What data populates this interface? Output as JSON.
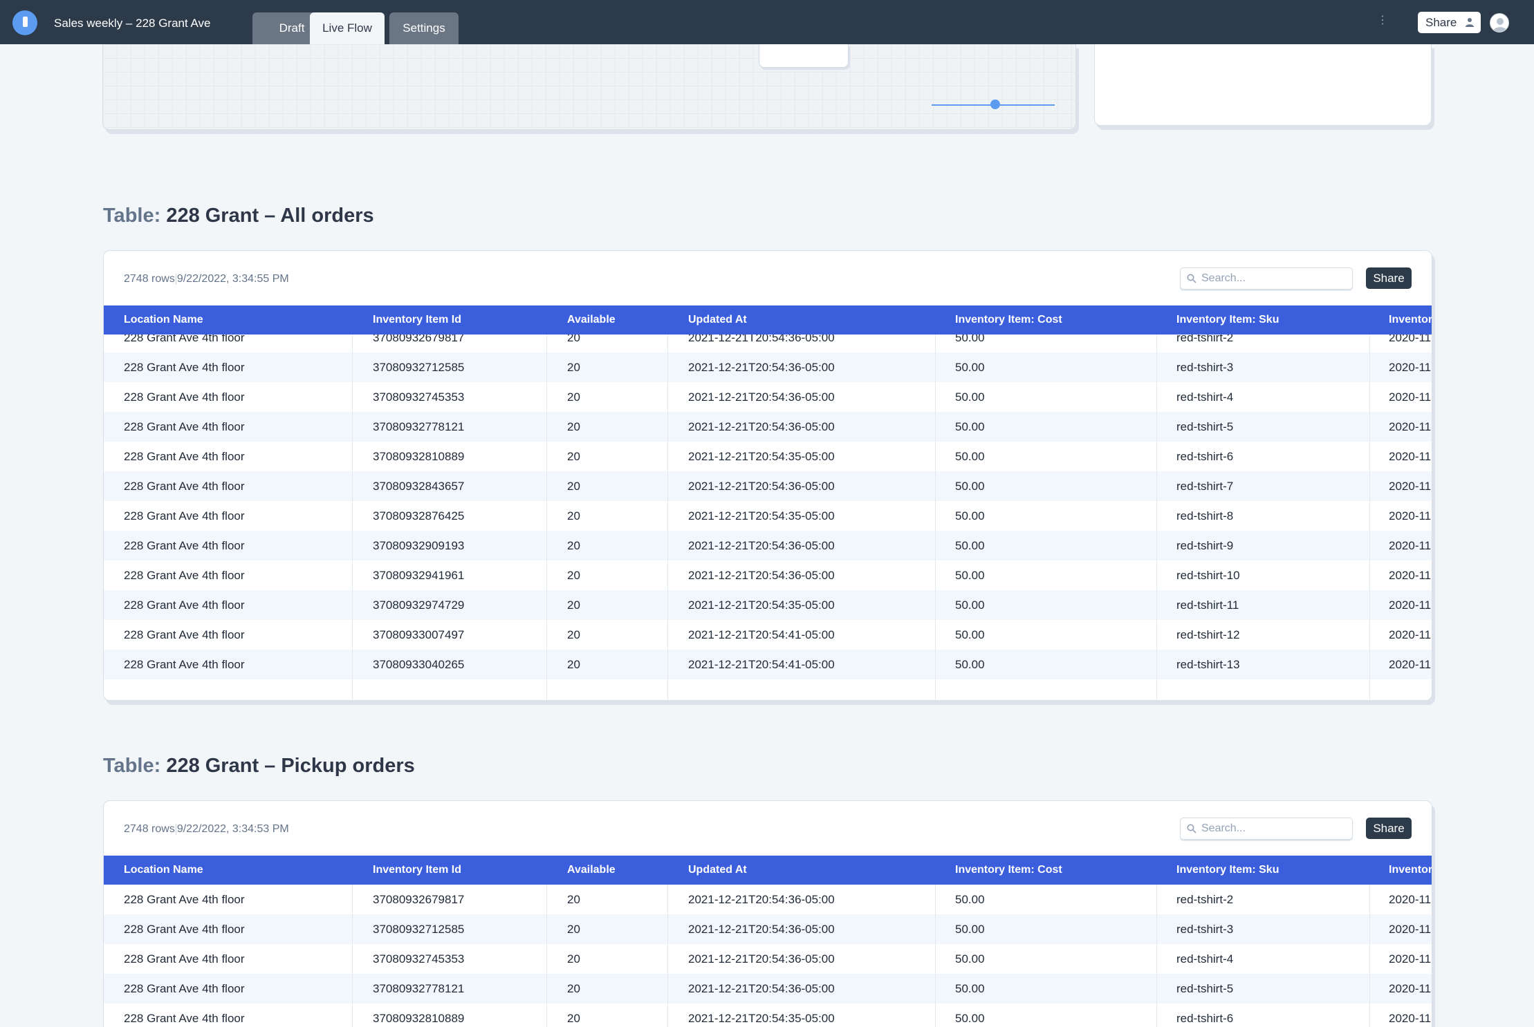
{
  "header": {
    "doc_title": "Sales weekly – 228 Grant Ave",
    "tabs": [
      {
        "label": "Draft",
        "active": false
      },
      {
        "label": "Live Flow",
        "active": true
      },
      {
        "label": "Settings",
        "active": false
      }
    ],
    "more_icon": "vertical-dots-icon",
    "share_label": "Share",
    "share_icon": "person-icon",
    "avatar_icon": "user-avatar-icon"
  },
  "colors": {
    "topbar": "#2d3a4a",
    "accent_blue": "#5b9cf0",
    "table_header": "#3b5fdc",
    "page_bg": "#f3f6f9"
  },
  "tables": [
    {
      "title_prefix": "Table:",
      "title": "228 Grant – All orders",
      "row_count": "2748 rows",
      "timestamp": "9/22/2022, 3:34:55 PM",
      "search_placeholder": "Search...",
      "share_label": "Share",
      "columns": [
        "Location Name",
        "Inventory Item Id",
        "Available",
        "Updated At",
        "Inventory Item: Cost",
        "Inventory Item: Sku",
        "Inventor"
      ],
      "rows": [
        [
          "228 Grant Ave 4th floor",
          "37080932679817",
          "20",
          "2021-12-21T20:54:36-05:00",
          "50.00",
          "red-tshirt-2",
          "2020-11"
        ],
        [
          "228 Grant Ave 4th floor",
          "37080932712585",
          "20",
          "2021-12-21T20:54:36-05:00",
          "50.00",
          "red-tshirt-3",
          "2020-11"
        ],
        [
          "228 Grant Ave 4th floor",
          "37080932745353",
          "20",
          "2021-12-21T20:54:36-05:00",
          "50.00",
          "red-tshirt-4",
          "2020-11"
        ],
        [
          "228 Grant Ave 4th floor",
          "37080932778121",
          "20",
          "2021-12-21T20:54:36-05:00",
          "50.00",
          "red-tshirt-5",
          "2020-11"
        ],
        [
          "228 Grant Ave 4th floor",
          "37080932810889",
          "20",
          "2021-12-21T20:54:35-05:00",
          "50.00",
          "red-tshirt-6",
          "2020-11"
        ],
        [
          "228 Grant Ave 4th floor",
          "37080932843657",
          "20",
          "2021-12-21T20:54:36-05:00",
          "50.00",
          "red-tshirt-7",
          "2020-11"
        ],
        [
          "228 Grant Ave 4th floor",
          "37080932876425",
          "20",
          "2021-12-21T20:54:35-05:00",
          "50.00",
          "red-tshirt-8",
          "2020-11"
        ],
        [
          "228 Grant Ave 4th floor",
          "37080932909193",
          "20",
          "2021-12-21T20:54:36-05:00",
          "50.00",
          "red-tshirt-9",
          "2020-11"
        ],
        [
          "228 Grant Ave 4th floor",
          "37080932941961",
          "20",
          "2021-12-21T20:54:36-05:00",
          "50.00",
          "red-tshirt-10",
          "2020-11"
        ],
        [
          "228 Grant Ave 4th floor",
          "37080932974729",
          "20",
          "2021-12-21T20:54:35-05:00",
          "50.00",
          "red-tshirt-11",
          "2020-11"
        ],
        [
          "228 Grant Ave 4th floor",
          "37080933007497",
          "20",
          "2021-12-21T20:54:41-05:00",
          "50.00",
          "red-tshirt-12",
          "2020-11"
        ],
        [
          "228 Grant Ave 4th floor",
          "37080933040265",
          "20",
          "2021-12-21T20:54:41-05:00",
          "50.00",
          "red-tshirt-13",
          "2020-11"
        ]
      ]
    },
    {
      "title_prefix": "Table:",
      "title": "228 Grant – Pickup orders",
      "row_count": "2748 rows",
      "timestamp": "9/22/2022, 3:34:53 PM",
      "search_placeholder": "Search...",
      "share_label": "Share",
      "columns": [
        "Location Name",
        "Inventory Item Id",
        "Available",
        "Updated At",
        "Inventory Item: Cost",
        "Inventory Item: Sku",
        "Inventor"
      ],
      "rows": [
        [
          "228 Grant Ave 4th floor",
          "37080932679817",
          "20",
          "2021-12-21T20:54:36-05:00",
          "50.00",
          "red-tshirt-2",
          "2020-11"
        ],
        [
          "228 Grant Ave 4th floor",
          "37080932712585",
          "20",
          "2021-12-21T20:54:36-05:00",
          "50.00",
          "red-tshirt-3",
          "2020-11"
        ],
        [
          "228 Grant Ave 4th floor",
          "37080932745353",
          "20",
          "2021-12-21T20:54:36-05:00",
          "50.00",
          "red-tshirt-4",
          "2020-11"
        ],
        [
          "228 Grant Ave 4th floor",
          "37080932778121",
          "20",
          "2021-12-21T20:54:36-05:00",
          "50.00",
          "red-tshirt-5",
          "2020-11"
        ],
        [
          "228 Grant Ave 4th floor",
          "37080932810889",
          "20",
          "2021-12-21T20:54:35-05:00",
          "50.00",
          "red-tshirt-6",
          "2020-11"
        ]
      ]
    }
  ]
}
